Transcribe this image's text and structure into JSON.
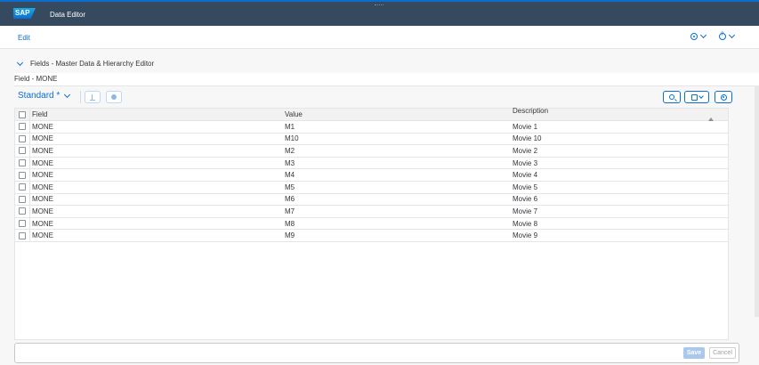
{
  "shell": {
    "logo": "SAP",
    "title": "Data Editor"
  },
  "subheader": {
    "edit_label": "Edit"
  },
  "section": {
    "title": "Fields - Master Data & Hierarchy Editor"
  },
  "field_label": "Field - MONE",
  "toolbar": {
    "variant": "Standard *"
  },
  "table": {
    "columns": [
      "Field",
      "Value",
      "Description"
    ],
    "rows": [
      [
        "MONE",
        "M1",
        "Movie 1"
      ],
      [
        "MONE",
        "M10",
        "Movie 10"
      ],
      [
        "MONE",
        "M2",
        "Movie 2"
      ],
      [
        "MONE",
        "M3",
        "Movie 3"
      ],
      [
        "MONE",
        "M4",
        "Movie 4"
      ],
      [
        "MONE",
        "M5",
        "Movie 5"
      ],
      [
        "MONE",
        "M6",
        "Movie 6"
      ],
      [
        "MONE",
        "M7",
        "Movie 7"
      ],
      [
        "MONE",
        "M8",
        "Movie 8"
      ],
      [
        "MONE",
        "M9",
        "Movie 9"
      ]
    ]
  },
  "footer": {
    "save_label": "Save",
    "cancel_label": "Cancel"
  },
  "colors": {
    "shell": "#354a5f",
    "accent": "#0a6ed1"
  }
}
